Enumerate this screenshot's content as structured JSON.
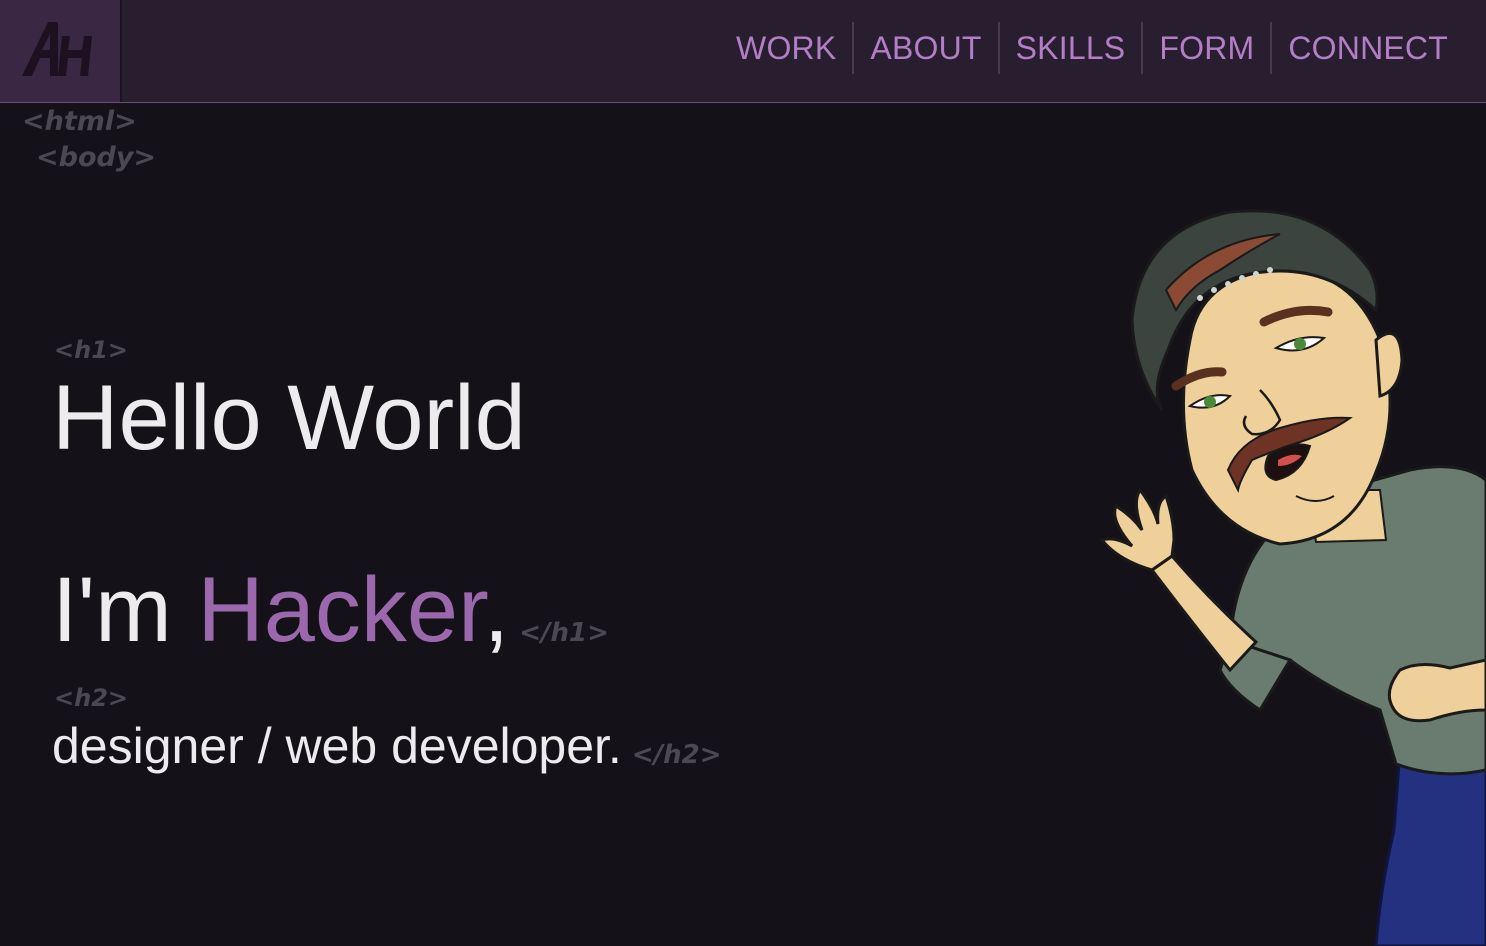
{
  "logo": {
    "text": "AH"
  },
  "nav": {
    "items": [
      {
        "label": "WORK"
      },
      {
        "label": "ABOUT"
      },
      {
        "label": "SKILLS"
      },
      {
        "label": "FORM"
      },
      {
        "label": "CONNECT"
      }
    ]
  },
  "code_tags": {
    "html_open": "<html>",
    "body_open": "<body>",
    "h1_open": "<h1>",
    "h1_close": "</h1>",
    "h2_open": "<h2>",
    "h2_close": "</h2>"
  },
  "hero": {
    "line1": "Hello World",
    "line2_prefix": "I'm ",
    "line2_name": "Hacker",
    "line2_suffix": ",",
    "subtitle": "designer / web developer."
  },
  "colors": {
    "background": "#151118",
    "topbar": "#281e30",
    "accent": "#9c68ad",
    "nav_text": "#b27fc6",
    "text": "#ecebee",
    "tag_text": "#4c4852"
  },
  "illustration": {
    "icon": "avatar-caricature-icon"
  }
}
